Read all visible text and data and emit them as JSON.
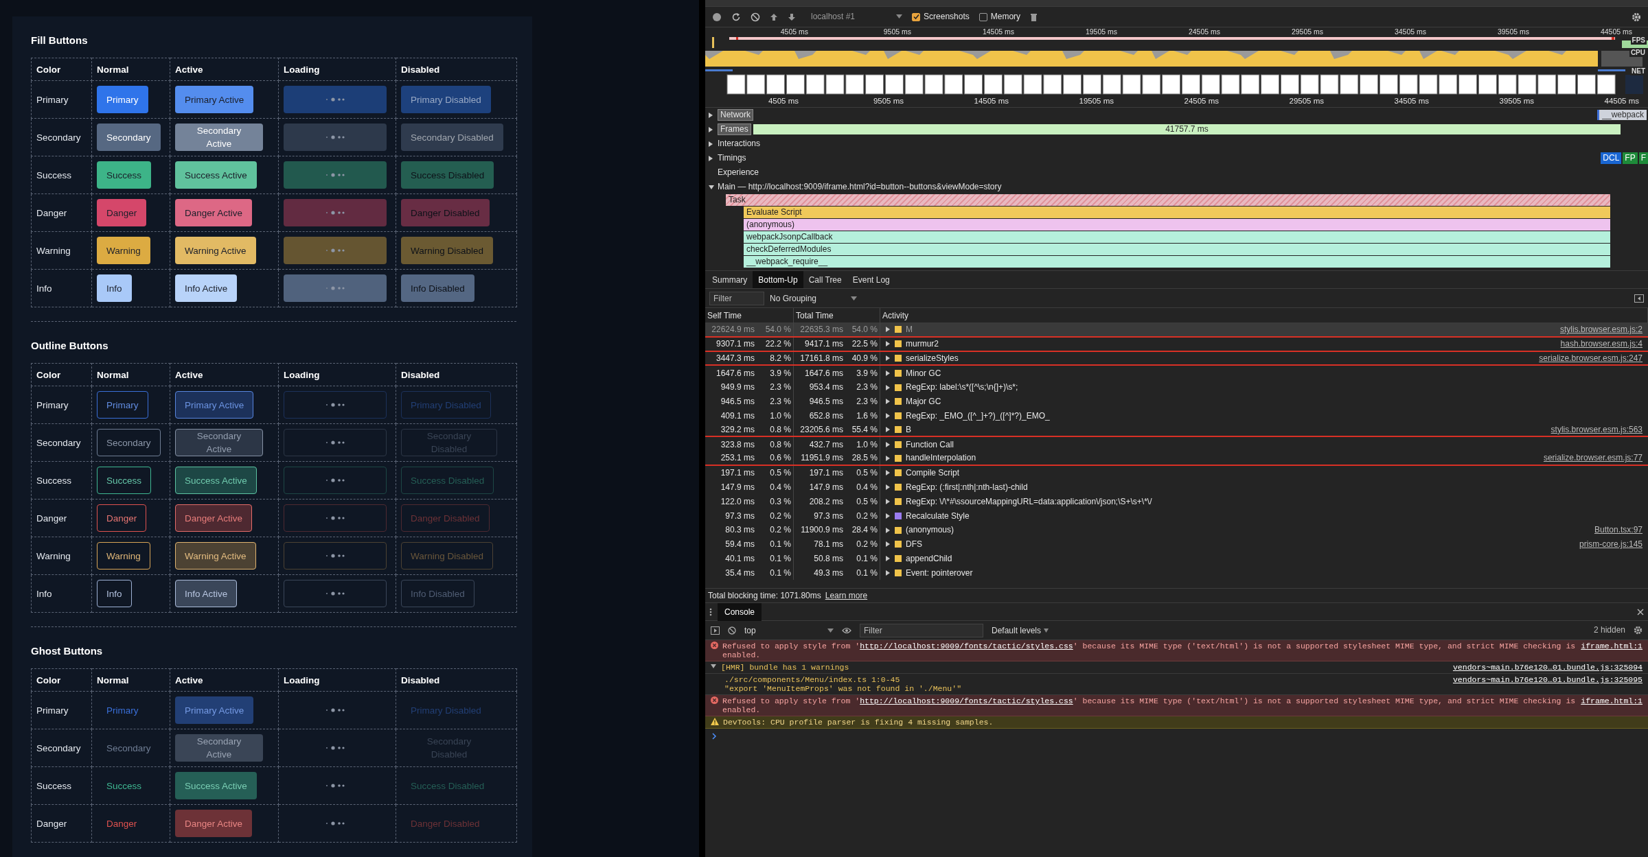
{
  "storybook": {
    "sections": [
      {
        "kind": "fill",
        "title": "Fill Buttons",
        "columns": [
          "Color",
          "Normal",
          "Active",
          "Loading",
          "Disabled"
        ],
        "rows": [
          {
            "label": "Primary",
            "color": "#2f74ea",
            "normal": "Primary",
            "active": "Primary Active",
            "disabled": "Primary Disabled"
          },
          {
            "label": "Secondary",
            "color": "#566882",
            "normal": "Secondary",
            "active": "Secondary Active",
            "disabled": "Secondary Disabled"
          },
          {
            "label": "Success",
            "color": "#3db488",
            "normal": "Success",
            "active": "Success Active",
            "disabled": "Success Disabled"
          },
          {
            "label": "Danger",
            "color": "#d5476a",
            "normal": "Danger",
            "active": "Danger Active",
            "disabled": "Danger Disabled"
          },
          {
            "label": "Warning",
            "color": "#dcab42",
            "normal": "Warning",
            "active": "Warning Active",
            "disabled": "Warning Disabled"
          },
          {
            "label": "Info",
            "color": "#a9c9f8",
            "normal": "Info",
            "active": "Info Active",
            "disabled": "Info Disabled"
          }
        ]
      },
      {
        "kind": "outline",
        "title": "Outline Buttons",
        "columns": [
          "Color",
          "Normal",
          "Active",
          "Loading",
          "Disabled"
        ],
        "rows": [
          {
            "label": "Primary",
            "color": "#3a6fd8",
            "normal": "Primary",
            "active": "Primary Active",
            "disabled": "Primary Disabled"
          },
          {
            "label": "Secondary",
            "color": "#6f7d94",
            "normal": "Secondary",
            "active": "Secondary Active",
            "disabled": "Secondary Disabled"
          },
          {
            "label": "Success",
            "color": "#3fb892",
            "normal": "Success",
            "active": "Success Active",
            "disabled": "Success Disabled"
          },
          {
            "label": "Danger",
            "color": "#e0524f",
            "normal": "Danger",
            "active": "Danger Active",
            "disabled": "Danger Disabled"
          },
          {
            "label": "Warning",
            "color": "#d9a556",
            "normal": "Warning",
            "active": "Warning Active",
            "disabled": "Warning Disabled"
          },
          {
            "label": "Info",
            "color": "#9fb2d6",
            "normal": "Info",
            "active": "Info Active",
            "disabled": "Info Disabled"
          }
        ]
      },
      {
        "kind": "ghost",
        "title": "Ghost Buttons",
        "columns": [
          "Color",
          "Normal",
          "Active",
          "Loading",
          "Disabled"
        ],
        "rows": [
          {
            "label": "Primary",
            "color": "#3a6fd8",
            "normal": "Primary",
            "active": "Primary Active",
            "disabled": "Primary Disabled"
          },
          {
            "label": "Secondary",
            "color": "#6f7d94",
            "normal": "Secondary",
            "active": "Secondary Active",
            "disabled": "Secondary Disabled"
          },
          {
            "label": "Success",
            "color": "#3fb892",
            "normal": "Success",
            "active": "Success Active",
            "disabled": "Success Disabled"
          },
          {
            "label": "Danger",
            "color": "#e0524f",
            "normal": "Danger",
            "active": "Danger Active",
            "disabled": "Danger Disabled"
          }
        ]
      }
    ]
  },
  "devtools": {
    "toolbar": {
      "target": "localhost #1",
      "checkboxes": [
        {
          "label": "Screenshots",
          "checked": true
        },
        {
          "label": "Memory",
          "checked": false
        }
      ]
    },
    "overview_ticks": [
      "4505 ms",
      "9505 ms",
      "14505 ms",
      "19505 ms",
      "24505 ms",
      "29505 ms",
      "34505 ms",
      "39505 ms",
      "44505 ms"
    ],
    "overview_tracks": [
      "FPS",
      "CPU",
      "NET"
    ],
    "ruler_ticks": [
      "4505 ms",
      "9505 ms",
      "14505 ms",
      "19505 ms",
      "24505 ms",
      "29505 ms",
      "34505 ms",
      "39505 ms",
      "44505 ms"
    ],
    "tracks": [
      {
        "kind": "boxed",
        "label": "Network",
        "expanded": false,
        "event": "__webpack"
      },
      {
        "kind": "boxed",
        "label": "Frames",
        "expanded": false,
        "value": "41757.7 ms"
      },
      {
        "kind": "plain",
        "label": "Interactions",
        "expanded": false
      },
      {
        "kind": "plain",
        "label": "Timings",
        "expanded": false,
        "markers": [
          {
            "label": "DCL",
            "color": "#1a66d2"
          },
          {
            "label": "FP",
            "color": "#1e8b3a"
          },
          {
            "label": "F",
            "color": "#1e8b3a"
          }
        ]
      },
      {
        "kind": "leaf",
        "label": "Experience"
      }
    ],
    "main": {
      "title": "Main — http://localhost:9009/iframe.html?id=button--buttons&viewMode=story",
      "expanded": true,
      "flame": [
        {
          "label": "Task",
          "color": "#e9b8c0"
        },
        {
          "label": "Evaluate Script",
          "color": "#f0c95a"
        },
        {
          "label": "(anonymous)",
          "color": "#eec3ee"
        },
        {
          "label": "webpackJsonpCallback",
          "color": "#b5f0dc"
        },
        {
          "label": "checkDeferredModules",
          "color": "#b5f0dc"
        },
        {
          "label": "__webpack_require__",
          "color": "#b5f0dc"
        }
      ]
    },
    "tabs": [
      {
        "label": "Summary",
        "selected": false
      },
      {
        "label": "Bottom-Up",
        "selected": true
      },
      {
        "label": "Call Tree",
        "selected": false
      },
      {
        "label": "Event Log",
        "selected": false
      }
    ],
    "filter": {
      "placeholder": "Filter"
    },
    "grouping": "No Grouping",
    "columns": [
      "Self Time",
      "Total Time",
      "Activity"
    ],
    "rows": [
      {
        "self": "22624.9 ms",
        "self_pct": "54.0 %",
        "total": "22635.3 ms",
        "total_pct": "54.0 %",
        "activity": "M",
        "color": "#f0c34a",
        "source": "stylis.browser.esm.js:2",
        "selected": true,
        "flagged": true
      },
      {
        "self": "9307.1 ms",
        "self_pct": "22.2 %",
        "total": "9417.1 ms",
        "total_pct": "22.5 %",
        "activity": "murmur2",
        "color": "#f0c34a",
        "source": "hash.browser.esm.js:4",
        "selected": false,
        "flagged": true
      },
      {
        "self": "3447.3 ms",
        "self_pct": "8.2 %",
        "total": "17161.8 ms",
        "total_pct": "40.9 %",
        "activity": "serializeStyles",
        "color": "#f0c34a",
        "source": "serialize.browser.esm.js:247",
        "selected": false,
        "flagged": true
      },
      {
        "self": "1647.6 ms",
        "self_pct": "3.9 %",
        "total": "1647.6 ms",
        "total_pct": "3.9 %",
        "activity": "Minor GC",
        "color": "#f0c34a",
        "selected": false,
        "flagged": false
      },
      {
        "self": "949.9 ms",
        "self_pct": "2.3 %",
        "total": "953.4 ms",
        "total_pct": "2.3 %",
        "activity": "RegExp: label:\\s*([^\\s;\\n{]+)\\s*;",
        "color": "#f0c34a",
        "selected": false,
        "flagged": false
      },
      {
        "self": "946.5 ms",
        "self_pct": "2.3 %",
        "total": "946.5 ms",
        "total_pct": "2.3 %",
        "activity": "Major GC",
        "color": "#f0c34a",
        "selected": false,
        "flagged": false
      },
      {
        "self": "409.1 ms",
        "self_pct": "1.0 %",
        "total": "652.8 ms",
        "total_pct": "1.6 %",
        "activity": "RegExp: _EMO_([^_]+?)_([^]*?)_EMO_",
        "color": "#f0c34a",
        "selected": false,
        "flagged": false
      },
      {
        "self": "329.2 ms",
        "self_pct": "0.8 %",
        "total": "23205.6 ms",
        "total_pct": "55.4 %",
        "activity": "B",
        "color": "#f0c34a",
        "source": "stylis.browser.esm.js:563",
        "selected": false,
        "flagged": true
      },
      {
        "self": "323.8 ms",
        "self_pct": "0.8 %",
        "total": "432.7 ms",
        "total_pct": "1.0 %",
        "activity": "Function Call",
        "color": "#f0c34a",
        "selected": false,
        "flagged": false
      },
      {
        "self": "253.1 ms",
        "self_pct": "0.6 %",
        "total": "11951.9 ms",
        "total_pct": "28.5 %",
        "activity": "handleInterpolation",
        "color": "#f0c34a",
        "source": "serialize.browser.esm.js:77",
        "selected": false,
        "flagged": true
      },
      {
        "self": "197.1 ms",
        "self_pct": "0.5 %",
        "total": "197.1 ms",
        "total_pct": "0.5 %",
        "activity": "Compile Script",
        "color": "#f0c34a",
        "selected": false,
        "flagged": false
      },
      {
        "self": "147.9 ms",
        "self_pct": "0.4 %",
        "total": "147.9 ms",
        "total_pct": "0.4 %",
        "activity": "RegExp: (:first|:nth|:nth-last)-child",
        "color": "#f0c34a",
        "selected": false,
        "flagged": false
      },
      {
        "self": "122.0 ms",
        "self_pct": "0.3 %",
        "total": "208.2 ms",
        "total_pct": "0.5 %",
        "activity": "RegExp: \\/\\*#\\ssourceMappingURL=data:application\\/json;\\S+\\s+\\*\\/",
        "color": "#f0c34a",
        "selected": false,
        "flagged": false
      },
      {
        "self": "97.3 ms",
        "self_pct": "0.2 %",
        "total": "97.3 ms",
        "total_pct": "0.2 %",
        "activity": "Recalculate Style",
        "color": "#9a7cf0",
        "selected": false,
        "flagged": false
      },
      {
        "self": "80.3 ms",
        "self_pct": "0.2 %",
        "total": "11900.9 ms",
        "total_pct": "28.4 %",
        "activity": "(anonymous)",
        "color": "#f0c34a",
        "source": "Button.tsx:97",
        "selected": false,
        "flagged": false
      },
      {
        "self": "59.4 ms",
        "self_pct": "0.1 %",
        "total": "78.1 ms",
        "total_pct": "0.2 %",
        "activity": "DFS",
        "color": "#f0c34a",
        "source": "prism-core.js:145",
        "selected": false,
        "flagged": false
      },
      {
        "self": "40.1 ms",
        "self_pct": "0.1 %",
        "total": "50.8 ms",
        "total_pct": "0.1 %",
        "activity": "appendChild",
        "color": "#f0c34a",
        "selected": false,
        "flagged": false
      },
      {
        "self": "35.4 ms",
        "self_pct": "0.1 %",
        "total": "49.3 ms",
        "total_pct": "0.1 %",
        "activity": "Event: pointerover",
        "color": "#f0c34a",
        "selected": false,
        "flagged": false
      }
    ],
    "total_blocking": {
      "text": "Total blocking time: 1071.80ms",
      "link": "Learn more"
    },
    "console": {
      "tab": "Console",
      "context": "top",
      "filter": {
        "placeholder": "Filter"
      },
      "levels": "Default levels",
      "hidden": "2 hidden",
      "messages": [
        {
          "kind": "error",
          "before": "Refused to apply style from '",
          "link": "http://localhost:9009/fonts/tactic/styles.css",
          "after": "' because its MIME type ('text/html') is not a supported stylesheet MIME type, and strict MIME checking is enabled.",
          "source": "iframe.html:1"
        },
        {
          "kind": "group",
          "text": "[HMR] bundle has 1 warnings",
          "expanded": true,
          "source": "vendors~main.b76e120…01.bundle.js:325094",
          "children": [
            {
              "lines": [
                "./src/components/Menu/index.ts 1:0-45",
                "\"export 'MenuItemProps' was not found in './Menu'\""
              ],
              "source": "vendors~main.b76e120…01.bundle.js:325095"
            }
          ]
        },
        {
          "kind": "error",
          "before": "Refused to apply style from '",
          "link": "http://localhost:9009/fonts/tactic/styles.css",
          "after": "' because its MIME type ('text/html') is not a supported stylesheet MIME type, and strict MIME checking is enabled.",
          "source": "iframe.html:1"
        },
        {
          "kind": "warning",
          "text": "DevTools: CPU profile parser is fixing 4 missing samples."
        }
      ]
    }
  }
}
